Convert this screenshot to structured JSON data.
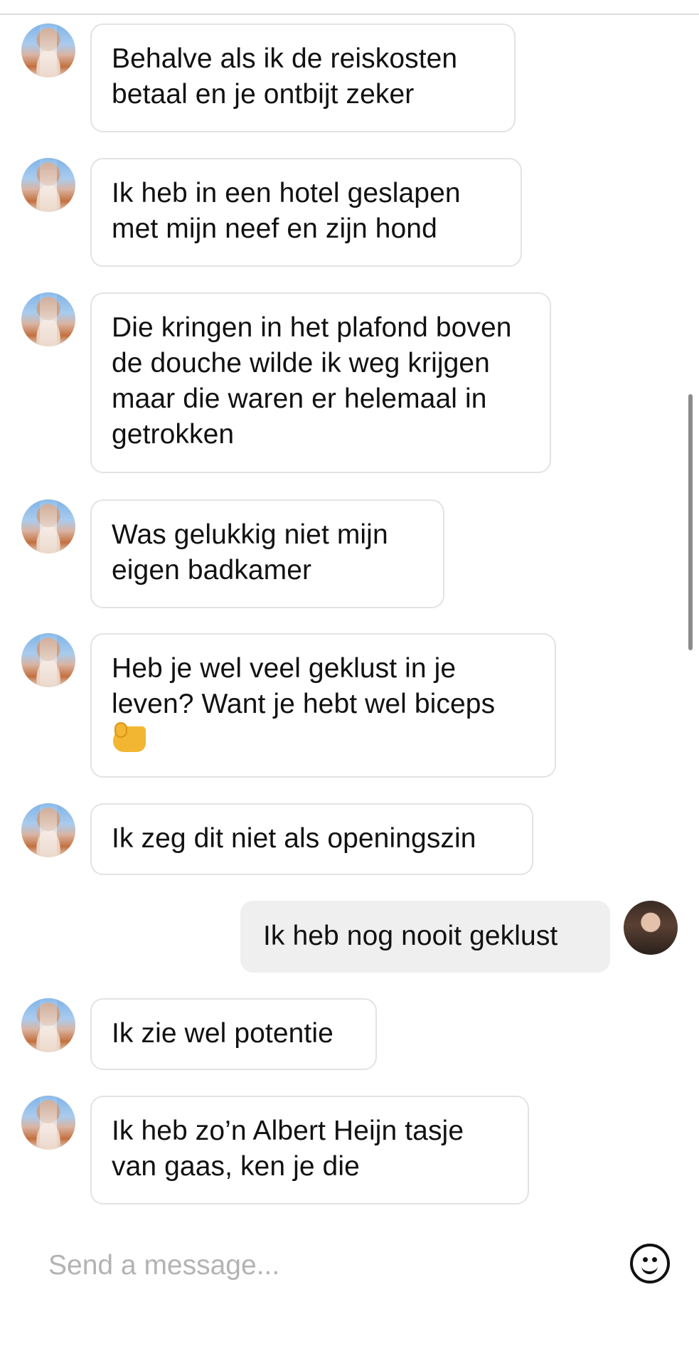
{
  "messages": [
    {
      "sender": "them",
      "text": "Behalve als ik de reiskosten betaal en je ontbijt zeker"
    },
    {
      "sender": "them",
      "text": "Ik heb in een hotel geslapen met mijn neef en zijn hond"
    },
    {
      "sender": "them",
      "text": "Die kringen in het plafond boven de douche wilde ik weg krijgen maar die waren er helemaal in getrokken"
    },
    {
      "sender": "them",
      "text": "Was gelukkig niet mijn eigen badkamer"
    },
    {
      "sender": "them",
      "text": "Heb je wel veel geklust in je leven? Want je hebt wel biceps",
      "emoji": "flexed-biceps-emoji"
    },
    {
      "sender": "them",
      "text": "Ik zeg dit niet als openingszin"
    },
    {
      "sender": "me",
      "text": "Ik heb nog nooit geklust"
    },
    {
      "sender": "them",
      "text": "Ik zie wel potentie"
    },
    {
      "sender": "them",
      "text": "Ik heb zo’n Albert Heijn tasje van gaas, ken je die"
    }
  ],
  "composer": {
    "placeholder": "Send a message...",
    "emoji_button_icon": "smiley-face-icon"
  },
  "colors": {
    "incoming_bubble_border": "#e3e3e3",
    "outgoing_bubble_bg": "#efefef",
    "placeholder": "#b3b3b3",
    "text": "#111111"
  }
}
